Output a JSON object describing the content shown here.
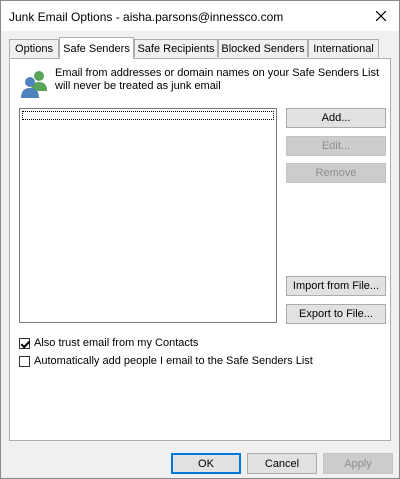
{
  "window": {
    "title": "Junk Email Options - aisha.parsons@innessco.com",
    "close_icon": "close-icon"
  },
  "tabs": [
    {
      "label": "Options",
      "active": false
    },
    {
      "label": "Safe Senders",
      "active": true
    },
    {
      "label": "Safe Recipients",
      "active": false
    },
    {
      "label": "Blocked Senders",
      "active": false
    },
    {
      "label": "International",
      "active": false
    }
  ],
  "panel": {
    "icon": "people-icon",
    "description": "Email from addresses or domain names on your Safe Senders List will never be treated as junk email",
    "list_items": [],
    "buttons": {
      "add": "Add...",
      "edit": "Edit...",
      "remove": "Remove",
      "import": "Import from File...",
      "export": "Export to File..."
    },
    "checkboxes": [
      {
        "label": "Also trust email from my Contacts",
        "checked": true
      },
      {
        "label": "Automatically add people I email to the Safe Senders List",
        "checked": false
      }
    ]
  },
  "footer": {
    "ok": "OK",
    "cancel": "Cancel",
    "apply": "Apply"
  },
  "colors": {
    "accent": "#0078d7",
    "disabled_text": "#8d8d8d",
    "icon_green": "#5aa55a",
    "icon_blue": "#4f81bd"
  }
}
